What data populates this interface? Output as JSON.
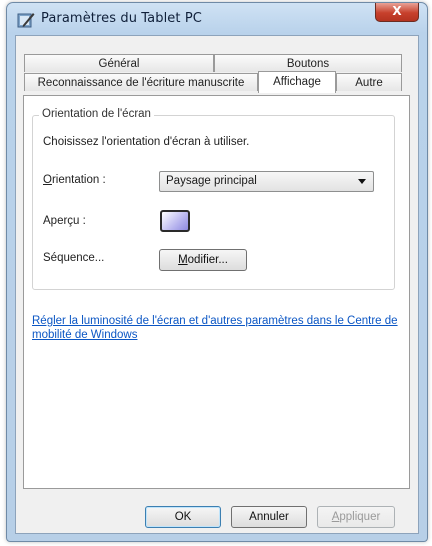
{
  "window": {
    "title": "Paramètres du Tablet PC",
    "close_label": "X"
  },
  "tabs": {
    "row_top": [
      {
        "label": "Général"
      },
      {
        "label": "Boutons"
      }
    ],
    "row_bottom": [
      {
        "label": "Reconnaissance de l'écriture manuscrite"
      },
      {
        "label": "Affichage",
        "active": true
      },
      {
        "label": "Autre"
      }
    ]
  },
  "orientation_group": {
    "legend": "Orientation de l'écran",
    "description": "Choisissez l'orientation d'écran à utiliser.",
    "orientation_label_accel": "O",
    "orientation_label_rest": "rientation :",
    "orientation_value": "Paysage principal",
    "preview_label": "Aperçu :",
    "sequence_label": "Séquence...",
    "modify_button_accel": "M",
    "modify_button_rest": "odifier..."
  },
  "mobility_link": "Régler la luminosité de l'écran et d'autres paramètres dans le Centre de mobilité de Windows",
  "footer": {
    "ok": "OK",
    "cancel": "Annuler",
    "apply_accel": "A",
    "apply_rest": "ppliquer"
  },
  "colors": {
    "link": "#0b56c4",
    "close_button": "#c7402c",
    "titlebar": "#cfe2f4"
  }
}
